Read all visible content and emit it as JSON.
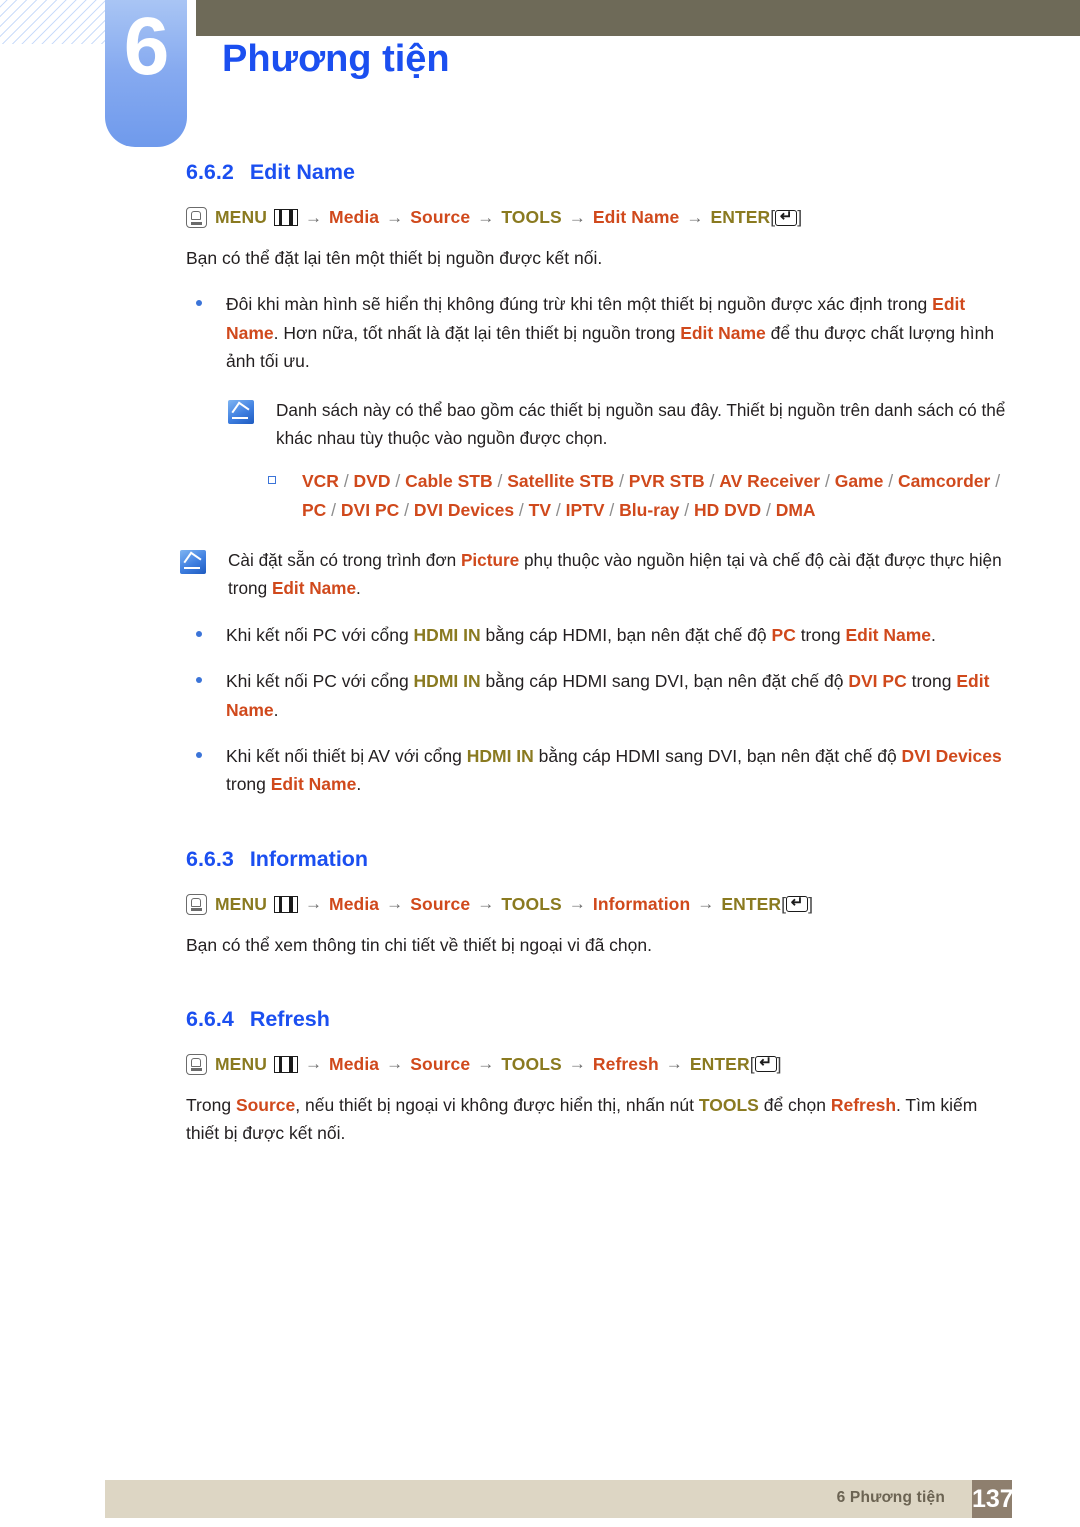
{
  "header": {
    "chapter_number": "6",
    "chapter_title": "Phương tiện"
  },
  "sections": [
    {
      "number": "6.6.2",
      "title": "Edit Name",
      "menu_path": {
        "menu_label": "MENU",
        "steps": [
          "Media",
          "Source",
          "TOOLS",
          "Edit Name"
        ],
        "enter_label": "ENTER",
        "arrow": "→",
        "bracket_open": "[",
        "bracket_close": "]"
      },
      "intro": "Bạn có thể đặt lại tên một thiết bị nguồn được kết nối."
    },
    {
      "number": "6.6.3",
      "title": "Information",
      "menu_path": {
        "menu_label": "MENU",
        "steps": [
          "Media",
          "Source",
          "TOOLS",
          "Information"
        ],
        "enter_label": "ENTER",
        "arrow": "→",
        "bracket_open": "[",
        "bracket_close": "]"
      },
      "intro": "Bạn có thể xem thông tin chi tiết về thiết bị ngoại vi đã chọn."
    },
    {
      "number": "6.6.4",
      "title": "Refresh",
      "menu_path": {
        "menu_label": "MENU",
        "steps": [
          "Media",
          "Source",
          "TOOLS",
          "Refresh"
        ],
        "enter_label": "ENTER",
        "arrow": "→",
        "bracket_open": "[",
        "bracket_close": "]"
      }
    }
  ],
  "bullets": {
    "edit_name_display": {
      "part1": "Đôi khi màn hình sẽ hiển thị không đúng trừ khi tên một thiết bị nguồn được xác định trong ",
      "em1": "Edit Name",
      "part2": ". Hơn nữa, tốt nhất là đặt lại tên thiết bị nguồn trong ",
      "em2": "Edit Name",
      "part3": " để thu được chất lượng hình ảnh tối ưu."
    },
    "hdmi_pc": {
      "part1": "Khi kết nối PC với cổng ",
      "em1": "HDMI IN",
      "part2": " bằng cáp HDMI, bạn nên đặt chế độ ",
      "em2": "PC",
      "part3": " trong ",
      "em3": "Edit Name",
      "part4": "."
    },
    "hdmi_dvi_pc": {
      "part1": "Khi kết nối PC với cổng ",
      "em1": "HDMI IN",
      "part2": " bằng cáp HDMI sang DVI, bạn nên đặt chế độ ",
      "em2": "DVI PC",
      "part3": " trong ",
      "em3": "Edit Name",
      "part4": "."
    },
    "hdmi_dvi_devices": {
      "part1": "Khi kết nối thiết bị AV với cổng ",
      "em1": "HDMI IN",
      "part2": " bằng cáp HDMI sang DVI, bạn nên đặt chế độ ",
      "em2": "DVI Devices",
      "part3": " trong ",
      "em3": "Edit Name",
      "part4": "."
    }
  },
  "notes": {
    "source_list": "Danh sách này có thể bao gồm các thiết bị nguồn sau đây. Thiết bị nguồn trên danh sách có thể khác nhau tùy thuộc vào nguồn được chọn.",
    "picture_preset": {
      "part1": "Cài đặt sẵn có trong trình đơn ",
      "em1": "Picture",
      "part2": " phụ thuộc vào nguồn hiện tại và chế độ cài đặt được thực hiện trong ",
      "em2": "Edit Name",
      "part3": "."
    }
  },
  "device_list": {
    "separator": " / ",
    "items": [
      "VCR",
      "DVD",
      "Cable STB",
      "Satellite STB",
      "PVR STB",
      "AV Receiver",
      "Game",
      "Camcorder",
      "PC",
      "DVI PC",
      "DVI Devices",
      "TV",
      "IPTV",
      "Blu-ray",
      "HD DVD",
      "DMA"
    ]
  },
  "refresh_body": {
    "part1": "Trong ",
    "em1": "Source",
    "part2": ", nếu thiết bị ngoại vi không được hiển thị, nhấn nút ",
    "em2": "TOOLS",
    "part3": " để chọn ",
    "em3": "Refresh",
    "part4": ". Tìm kiếm thiết bị được kết nối."
  },
  "footer": {
    "label": "6 Phương tiện",
    "page_number": "137"
  },
  "colors": {
    "heading_blue": "#1b4ff0",
    "accent_red": "#d0491c",
    "accent_olive": "#8a7a20",
    "header_gray": "#6e6a58",
    "footer_beige": "#ddd6c4",
    "footer_brown": "#8e7f6e"
  }
}
